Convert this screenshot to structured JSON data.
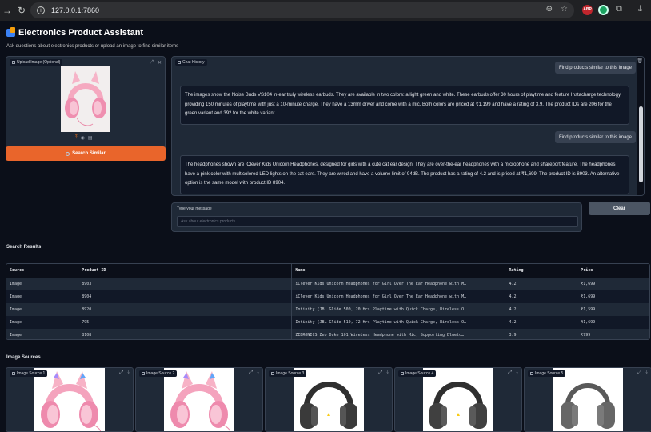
{
  "browser": {
    "url": "127.0.0.1:7860",
    "ext_abp": "ABP"
  },
  "app": {
    "title": "Electronics Product Assistant",
    "subtitle": "Ask questions about electronics products or upload an image to find similar items"
  },
  "upload": {
    "label": "Upload Image (Optional)"
  },
  "search_button": "Search Similar",
  "chat": {
    "label": "Chat History",
    "messages": [
      {
        "role": "user",
        "text": "Find products similar to this image"
      },
      {
        "role": "assistant",
        "text": "The images show the Noise Buds VS104 in-ear truly wireless earbuds. They are available in two colors: a light green and white. These earbuds offer 30 hours of playtime and feature Instacharge technology, providing 150 minutes of playtime with just a 10-minute charge. They have a 13mm driver and come with a mic. Both colors are priced at ₹1,199 and have a rating of 3.9. The product IDs are 206 for the green variant and 392 for the white variant."
      },
      {
        "role": "user",
        "text": "Find products similar to this image"
      },
      {
        "role": "assistant",
        "text": "The headphones shown are iClever Kids Unicorn Headphones, designed for girls with a cute cat ear design. They are over-the-ear headphones with a microphone and shareport feature. The headphones have a pink color with multicolored LED lights on the cat ears. They are wired and have a volume limit of 94dB. The product has a rating of 4.2 and is priced at ₹1,699. The product ID is 8903. An alternative option is the same model with product ID 8904."
      }
    ]
  },
  "input": {
    "label": "Type your message",
    "placeholder": "Ask about electronics products..."
  },
  "clear_button": "Clear",
  "results": {
    "heading": "Search Results",
    "columns": [
      "Source",
      "Product ID",
      "Name",
      "Rating",
      "Price"
    ],
    "rows": [
      [
        "Image",
        "8903",
        "iClever Kids Unicorn Headphones for Girl Over The Ear Headphone with M…",
        "4.2",
        "₹1,699"
      ],
      [
        "Image",
        "8904",
        "iClever Kids Unicorn Headphones for Girl Over The Ear Headphone with M…",
        "4.2",
        "₹1,699"
      ],
      [
        "Image",
        "8920",
        "Infinity (JBL Glide 500, 20 Hrs Playtime with Quick Charge, Wireless O…",
        "4.2",
        "₹1,599"
      ],
      [
        "Image",
        "795",
        "Infinity (JBL Glide 510, 72 Hrs Playtime with Quick Charge, Wireless O…",
        "4.2",
        "₹1,699"
      ],
      [
        "Image",
        "8108",
        "ZEBRONICS Zeb Duke 101 Wireless Headphone with Mic, Supporting Blueto…",
        "3.9",
        "₹799"
      ]
    ]
  },
  "gallery": {
    "heading": "Image Sources",
    "items": [
      {
        "label": "Image Source 1",
        "kind": "pink"
      },
      {
        "label": "Image Source 2",
        "kind": "pink"
      },
      {
        "label": "Image Source 3",
        "kind": "black"
      },
      {
        "label": "Image Source 4",
        "kind": "black"
      },
      {
        "label": "Image Source 5",
        "kind": "grey"
      }
    ]
  },
  "colors": {
    "accent": "#e9652b",
    "background": "#0b0f19",
    "panel": "#1f2937",
    "border": "#374151"
  }
}
